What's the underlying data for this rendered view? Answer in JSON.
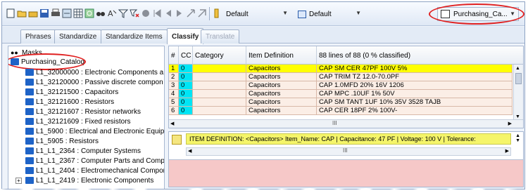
{
  "toolbar": {
    "combo1": "Default",
    "combo2": "Default",
    "catalog_combo": "Purchasing_Ca..."
  },
  "tabs": [
    {
      "label": "Phrases"
    },
    {
      "label": "Standardize"
    },
    {
      "label": "Standardize Items"
    },
    {
      "label": "Classify"
    },
    {
      "label": "Translate"
    }
  ],
  "tree": {
    "masks": "Masks",
    "root": "Purchasing_Catalog",
    "items": [
      "L1_32000000  :  Electronic Components a",
      "L1_32120000  :  Passive discrete compon",
      "L1_32121500  :  Capacitors",
      "L1_32121600  :  Resistors",
      "L1_32121607  :  Resistor networks",
      "L1_32121609  :  Fixed resistors",
      "L1_5900  :  Electrical and Electronic Equip",
      "L1_5905  :  Resistors",
      "L1_L1_2364  :  Computer Systems",
      "L1_L1_2367  :  Computer Parts and Comp",
      "L1_L1_2404  :  Electromechanical Compor",
      "L1_L1_2419  :  Electronic Components"
    ]
  },
  "grid": {
    "headers": [
      "#",
      "CC",
      "Category",
      "Item Definition",
      "88 lines of 88 (0 % classified)"
    ],
    "rows": [
      {
        "num": "1",
        "cc": "0",
        "category": "",
        "def": "Capacitors",
        "desc": "CAP SM CER 47PF 100V 5%"
      },
      {
        "num": "2",
        "cc": "0",
        "category": "",
        "def": "Capacitors",
        "desc": "CAP TRIM TZ 12.0-70.0PF"
      },
      {
        "num": "3",
        "cc": "0",
        "category": "",
        "def": "Capacitors",
        "desc": "CAP 1.0MFD 20% 16V 1206"
      },
      {
        "num": "4",
        "cc": "0",
        "category": "",
        "def": "Capacitors",
        "desc": "CAP MPC .10UF 1% 50V"
      },
      {
        "num": "5",
        "cc": "0",
        "category": "",
        "def": "Capacitors",
        "desc": "CAP SM TANT 1UF 10% 35V 3528 TAJB"
      },
      {
        "num": "6",
        "cc": "0",
        "category": "",
        "def": "Capacitors",
        "desc": "CAP CER 18PF 2% 100V-"
      }
    ],
    "hscroll_label": "III"
  },
  "detail": {
    "text": "ITEM DEFINITION: <Capacitors>  Item_Name: CAP | Capacitance: 47 PF | Voltage: 100 V | Tolerance:",
    "hscroll_label": "III"
  },
  "colors": {
    "selected_row": "#ffff00",
    "row_bg": "#fbeee6",
    "cc_cell": "#00e5f5",
    "highlight": "#e02020"
  }
}
